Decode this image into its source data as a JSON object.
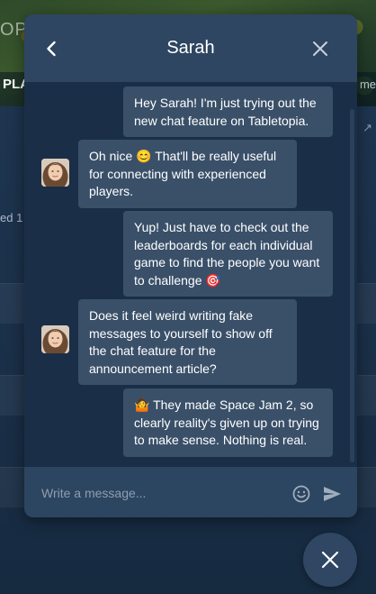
{
  "background": {
    "logo_fragment": "OP",
    "tab_fragment": "PLA",
    "right_fragment": "me",
    "side_fragment": "ed 1"
  },
  "chat": {
    "title": "Sarah",
    "messages": [
      {
        "direction": "out",
        "text": "Hey Sarah! I'm just trying out the new chat feature on Tabletopia."
      },
      {
        "direction": "in",
        "text": "Oh nice 😊 That'll be really useful for connecting with experienced players."
      },
      {
        "direction": "out",
        "text": "Yup! Just have to check out the leaderboards for each individual game to find the people you want to challenge 🎯"
      },
      {
        "direction": "in",
        "text": "Does it feel weird writing fake messages to yourself to show off the chat feature for the announcement article?"
      },
      {
        "direction": "out",
        "text": "🤷 They made Space Jam 2, so clearly reality's given up on trying to make sense. Nothing is real."
      }
    ],
    "input": {
      "placeholder": "Write a message...",
      "value": ""
    }
  },
  "icons": {
    "back": "chevron-left-icon",
    "close": "close-icon",
    "emoji": "smiley-icon",
    "send": "send-icon",
    "fab": "close-icon"
  },
  "colors": {
    "header": "#2e4661",
    "body": "#1a2e47",
    "bubble": "#3a5069"
  }
}
